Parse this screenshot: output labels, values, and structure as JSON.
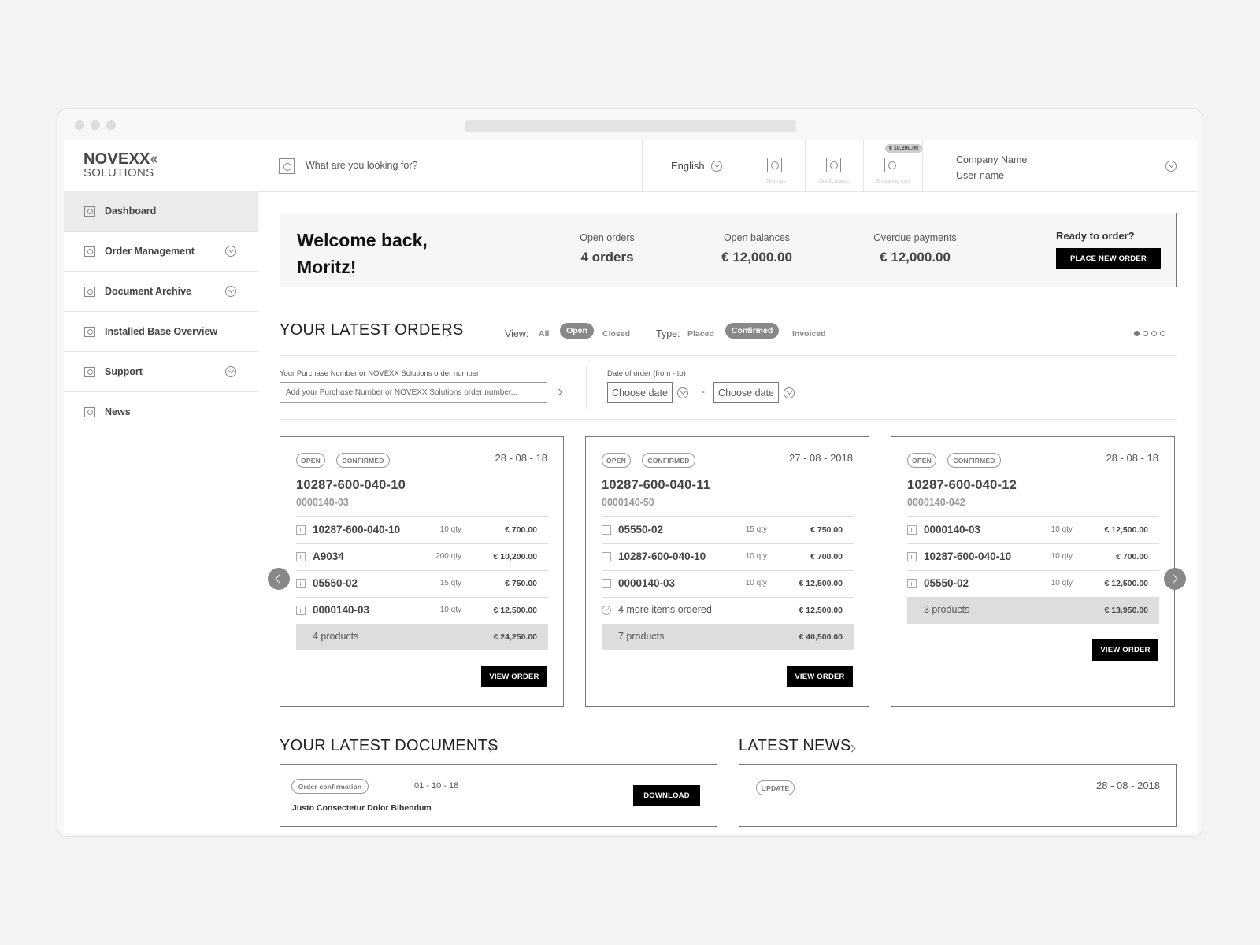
{
  "logo": {
    "line1": "NOVEXX",
    "chevrons": "‹‹",
    "line2": "SOLUTIONS"
  },
  "sidebar": {
    "items": [
      {
        "label": "Dashboard",
        "active": true,
        "expandable": false
      },
      {
        "label": "Order Management",
        "active": false,
        "expandable": true
      },
      {
        "label": "Document Archive",
        "active": false,
        "expandable": true
      },
      {
        "label": "Installed Base Overview",
        "active": false,
        "expandable": false
      },
      {
        "label": "Support",
        "active": false,
        "expandable": true
      },
      {
        "label": "News",
        "active": false,
        "expandable": false
      }
    ]
  },
  "topbar": {
    "search_placeholder": "What are you looking for?",
    "language": "English",
    "settings_label": "Settings",
    "notifications_label": "Notifications",
    "cart_label": "Shopping cart",
    "cart_badge": "€ 10,200.00",
    "company_name": "Company Name",
    "user_name": "User name"
  },
  "welcome": {
    "greeting": "Welcome back, Moritz!",
    "open_orders_label": "Open orders",
    "open_orders_value": "4 orders",
    "open_balances_label": "Open balances",
    "open_balances_value": "€ 12,000.00",
    "overdue_label": "Overdue payments",
    "overdue_value": "€ 12,000.00",
    "ready_label": "Ready to order?",
    "place_order_label": "PLACE NEW ORDER"
  },
  "orders_section": {
    "title": "YOUR LATEST ORDERS",
    "view_label": "View:",
    "view_options": [
      "All",
      "Open",
      "Closed"
    ],
    "view_selected": "Open",
    "type_label": "Type:",
    "type_options": [
      "Placed",
      "Confirmed",
      "Invoiced"
    ],
    "type_selected": "Confirmed",
    "pager_total": 4,
    "pager_active": 1,
    "search_label": "Your Purchase Number or NOVEXX Solutions order number",
    "search_placeholder": "Add your Purchase Number or NOVEXX Solutions order number...",
    "date_label": "Date of order (from - to)",
    "date_from_placeholder": "Choose date",
    "date_separator": "-",
    "date_to_placeholder": "Choose date"
  },
  "orders": [
    {
      "tags": [
        "OPEN",
        "CONFIRMED"
      ],
      "date": "28 - 08 - 18",
      "number": "10287-600-040-10",
      "sub": "0000140-03",
      "items": [
        {
          "name": "10287-600-040-10",
          "qty": "10 qty",
          "price": "€ 700.00"
        },
        {
          "name": "A9034",
          "qty": "200 qty",
          "price": "€ 10,200.00"
        },
        {
          "name": "05550-02",
          "qty": "15 qty",
          "price": "€ 750.00"
        },
        {
          "name": "0000140-03",
          "qty": "10 qty",
          "price": "€ 12,500.00"
        }
      ],
      "total_label": "4 products",
      "total_price": "€ 24,250.00",
      "view_label": "VIEW ORDER"
    },
    {
      "tags": [
        "OPEN",
        "CONFIRMED"
      ],
      "date": "27 - 08 - 2018",
      "number": "10287-600-040-11",
      "sub": "0000140-50",
      "items": [
        {
          "name": "05550-02",
          "qty": "15 qty",
          "price": "€ 750.00"
        },
        {
          "name": "10287-600-040-10",
          "qty": "10 qty",
          "price": "€ 700.00"
        },
        {
          "name": "0000140-03",
          "qty": "10 qty",
          "price": "€ 12,500.00"
        },
        {
          "name": "4 more items ordered",
          "qty": "",
          "price": "€ 12,500.00",
          "more": true
        }
      ],
      "total_label": "7 products",
      "total_price": "€ 40,500.00",
      "view_label": "VIEW ORDER"
    },
    {
      "tags": [
        "OPEN",
        "CONFIRMED"
      ],
      "date": "28 - 08 - 18",
      "number": "10287-600-040-12",
      "sub": "0000140-042",
      "items": [
        {
          "name": "0000140-03",
          "qty": "10 qty",
          "price": "€ 12,500.00"
        },
        {
          "name": "10287-600-040-10",
          "qty": "10 qty",
          "price": "€ 700.00"
        },
        {
          "name": "05550-02",
          "qty": "10 qty",
          "price": "€ 12,500.00"
        }
      ],
      "total_label": "3 products",
      "total_price": "€ 13,950.00",
      "view_label": "VIEW ORDER"
    }
  ],
  "documents_section": {
    "title": "YOUR LATEST DOCUMENTS",
    "first": {
      "tag": "Order confirmation",
      "date": "01 - 10 - 18",
      "title": "Justo Consectetur Dolor Bibendum",
      "download_label": "DOWNLOAD"
    }
  },
  "news_section": {
    "title": "LATEST NEWS",
    "first": {
      "tag": "UPDATE",
      "date": "28 - 08 - 2018"
    }
  }
}
